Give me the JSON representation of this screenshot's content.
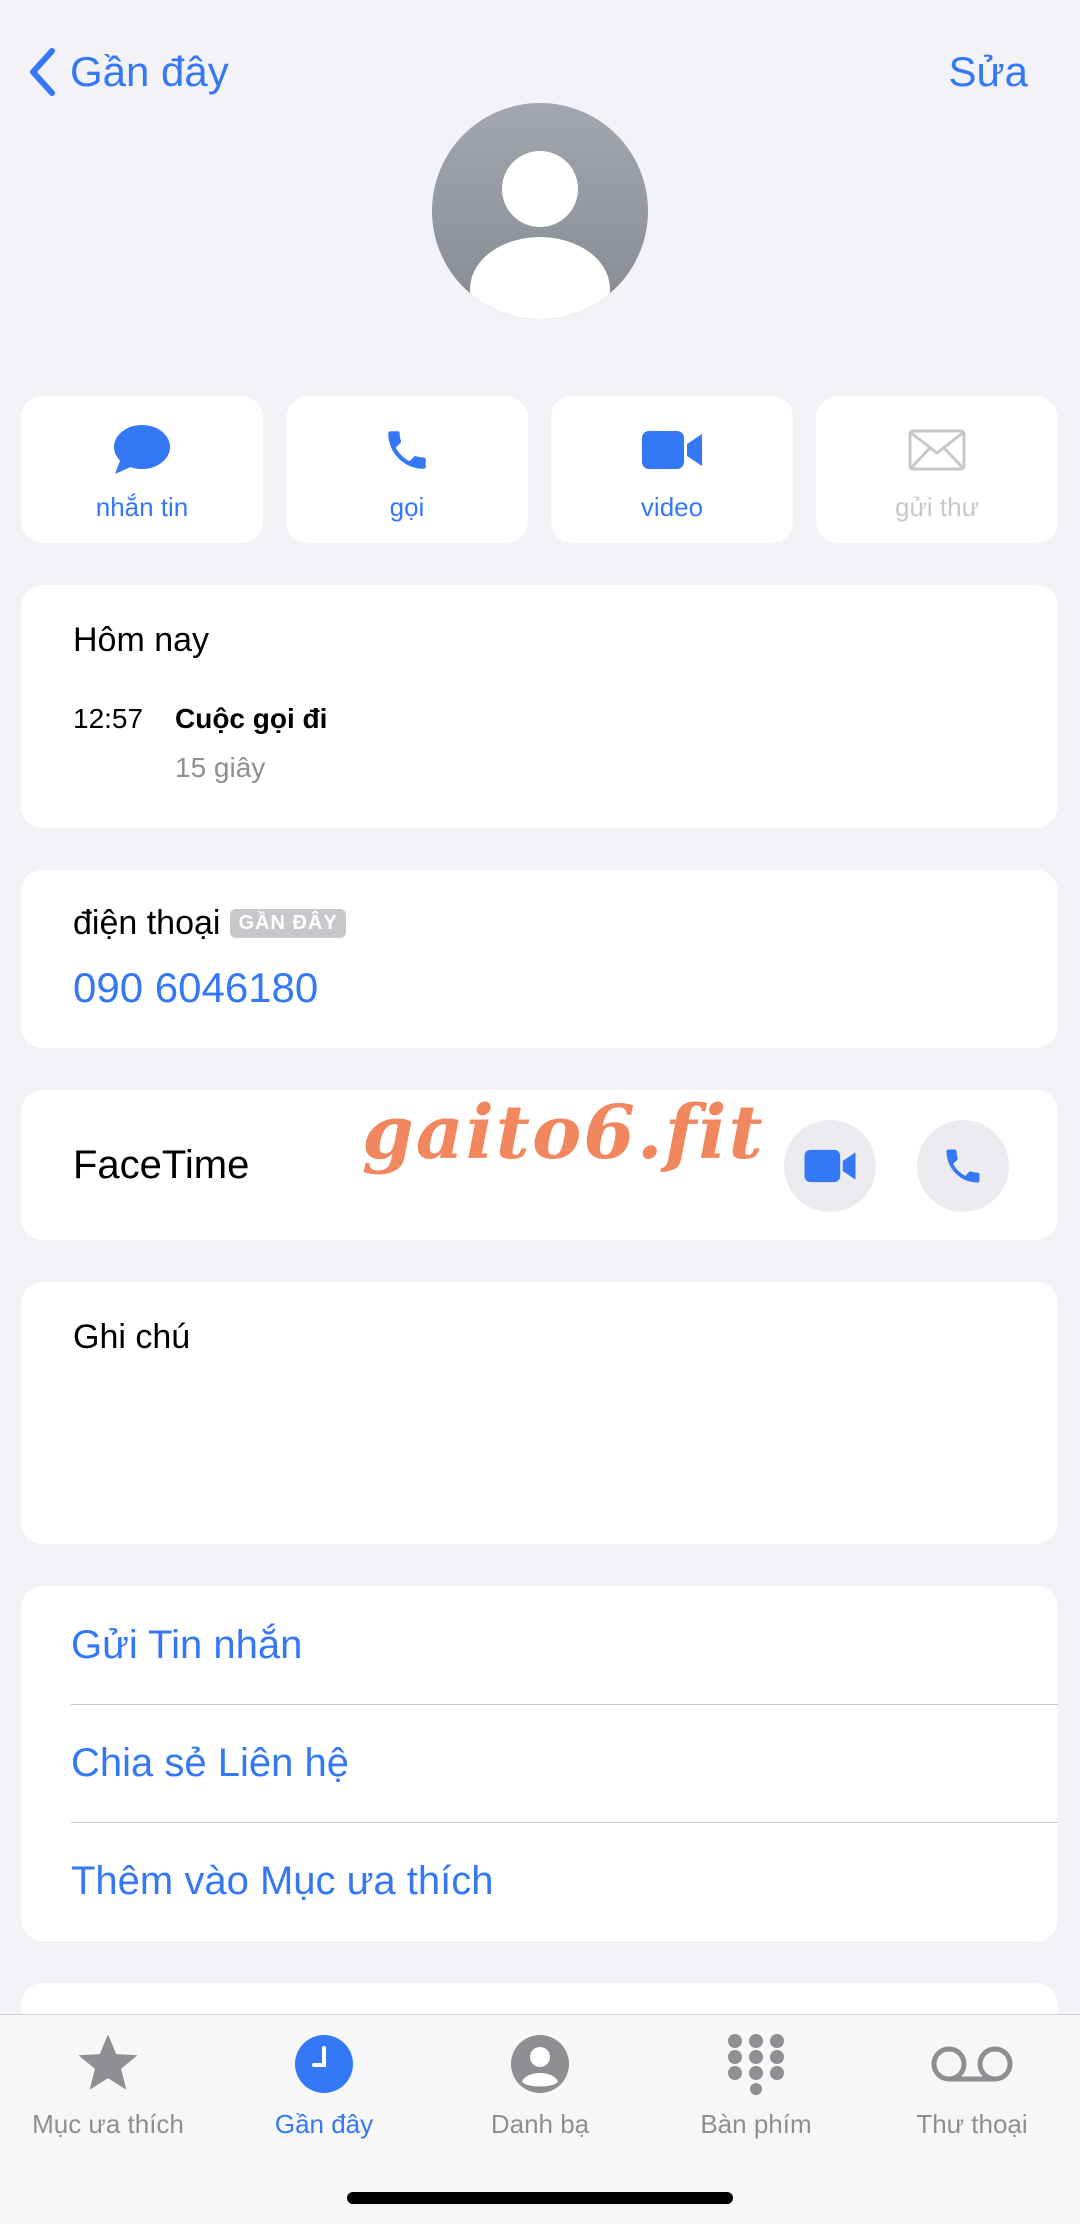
{
  "nav": {
    "back_label": "Gần đây",
    "edit_label": "Sửa"
  },
  "actions": [
    {
      "label": "nhắn tin",
      "icon": "message-bubble-icon"
    },
    {
      "label": "gọi",
      "icon": "phone-icon"
    },
    {
      "label": "video",
      "icon": "video-camera-icon"
    },
    {
      "label": "gửi thư",
      "icon": "envelope-icon"
    }
  ],
  "recent": {
    "title": "Hôm nay",
    "time": "12:57",
    "call_type": "Cuộc gọi đi",
    "duration": "15 giây"
  },
  "phone": {
    "label": "điện thoại",
    "badge": "GẦN ĐÂY",
    "number": "090 6046180"
  },
  "facetime": {
    "label": "FaceTime"
  },
  "watermark": "gaito6.fit",
  "notes": {
    "label": "Ghi chú"
  },
  "links": [
    "Gửi Tin nhắn",
    "Chia sẻ Liên hệ",
    "Thêm vào Mục ưa thích"
  ],
  "tabs": [
    {
      "label": "Mục ưa thích",
      "icon": "star-icon"
    },
    {
      "label": "Gần đây",
      "icon": "clock-icon"
    },
    {
      "label": "Danh bạ",
      "icon": "contacts-icon"
    },
    {
      "label": "Bàn phím",
      "icon": "keypad-icon"
    },
    {
      "label": "Thư thoại",
      "icon": "voicemail-icon"
    }
  ],
  "colors": {
    "accent": "#3478f6",
    "background": "#f2f2f7",
    "watermark": "#f0875f"
  }
}
